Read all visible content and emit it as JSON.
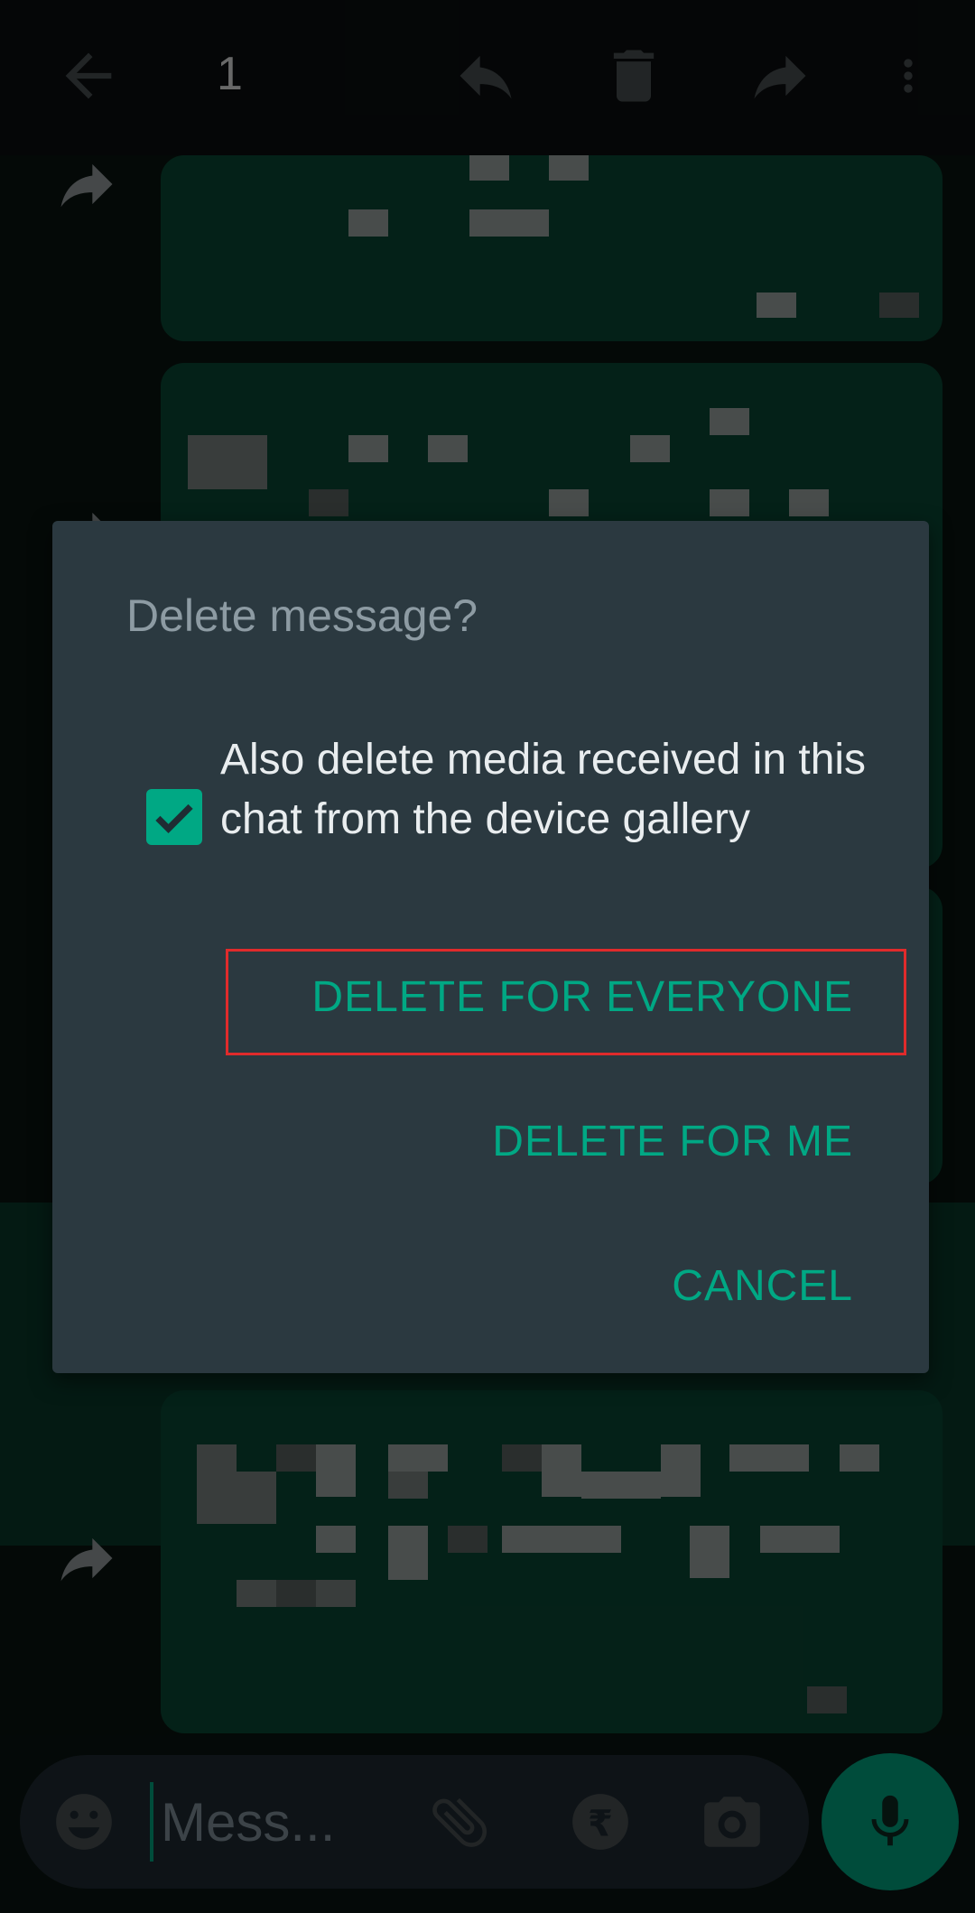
{
  "header": {
    "selected_count": "1",
    "icons": [
      "back-arrow-icon",
      "reply-icon",
      "delete-icon",
      "forward-icon",
      "more-vert-icon"
    ]
  },
  "composer": {
    "placeholder": "Mess...",
    "icons": [
      "emoji-icon",
      "attach-icon",
      "payment-icon",
      "camera-icon",
      "mic-icon"
    ]
  },
  "dialog": {
    "title": "Delete message?",
    "checkbox_label": "Also delete media received in this chat from the device gallery",
    "checkbox_checked": true,
    "delete_everyone": "DELETE FOR EVERYONE",
    "delete_me": "DELETE FOR ME",
    "cancel": "CANCEL"
  },
  "colors": {
    "accent": "#00a884",
    "dialog_bg": "#2b3940",
    "bubble": "#0a4a36",
    "highlight": "#e02b2b"
  }
}
